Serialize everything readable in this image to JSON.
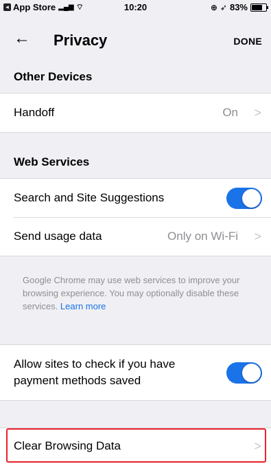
{
  "status_bar": {
    "back_app": "App Store",
    "time": "10:20",
    "battery": "83%",
    "battery_level": 0.83
  },
  "nav": {
    "title": "Privacy",
    "done": "DONE"
  },
  "sections": {
    "other_devices": {
      "header": "Other Devices",
      "handoff_label": "Handoff",
      "handoff_value": "On"
    },
    "web_services": {
      "header": "Web Services",
      "search_suggestions_label": "Search and Site Suggestions",
      "search_suggestions_on": true,
      "usage_data_label": "Send usage data",
      "usage_data_value": "Only on Wi-Fi",
      "footnote": "Google Chrome may use web services to improve your browsing experience. You may optionally disable these services.",
      "learn_more": "Learn more"
    },
    "payment": {
      "label": "Allow sites to check if you have payment methods saved",
      "on": true
    },
    "clear": {
      "label": "Clear Browsing Data"
    }
  },
  "colors": {
    "accent": "#1a73e8",
    "highlight": "#e8202a"
  }
}
